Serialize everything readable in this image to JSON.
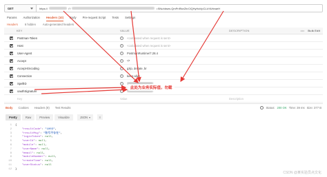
{
  "request": {
    "method": "GET",
    "url_start": "https://",
    "url_mid": "/?",
    "url_end": "=SNuhbses.QmPnRkeZhrClQHyHaVpCLkYAHeaeH"
  },
  "tabs": [
    "Params",
    "Authorization",
    "Headers (10)",
    "Body",
    "Pre-request Script",
    "Tests",
    "Settings"
  ],
  "active_tab_index": 2,
  "subtabs": {
    "headers": "Headers",
    "hidden": "6 hidden",
    "auto": "Auto-generated headers"
  },
  "table": {
    "columns": {
      "key": "KEY",
      "value": "VALUE",
      "description": "DESCRIPTION",
      "bulk_edit": "Bulk Edit",
      "more": "•••"
    },
    "rows": [
      {
        "key": "Postman-Token",
        "value": "<calculated when request is sent>",
        "placeholder": true
      },
      {
        "key": "Host",
        "value": "<calculated when request is sent>",
        "placeholder": true
      },
      {
        "key": "User-Agent",
        "value": "PostmanRuntime/7.28.4",
        "placeholder": false
      },
      {
        "key": "Accept",
        "value": "*/*",
        "placeholder": false
      },
      {
        "key": "Accept-Encoding",
        "value": "gzip, deflate, br",
        "placeholder": false
      },
      {
        "key": "Connection",
        "value": "keep-alive",
        "placeholder": false
      },
      {
        "key": "SpellID",
        "value": "",
        "placeholder": false
      },
      {
        "key": "oauthSignature",
        "value": "",
        "placeholder": false
      }
    ],
    "new_row": {
      "key": "Key",
      "value": "Value",
      "description": "Description"
    }
  },
  "annotation": "此处为业务实际值，勿截",
  "response": {
    "tabs": [
      "Body",
      "Cookies",
      "Headers (9)",
      "Test Results"
    ],
    "status_label": "Status:",
    "status_value": "200 OK",
    "time": "Time: 39 ms",
    "size": "Size: 377 B",
    "views": [
      "Pretty",
      "Raw",
      "Preview",
      "Visualize"
    ],
    "format": "JSON"
  },
  "json_lines": [
    {
      "n": "1",
      "parts": [
        [
          "pun",
          "{"
        ]
      ]
    },
    {
      "n": "2",
      "parts": [
        [
          "key",
          "    \"resultCode\""
        ],
        [
          "pun",
          ": "
        ],
        [
          "str",
          "\"1003\""
        ],
        [
          "pun",
          ","
        ]
      ]
    },
    {
      "n": "3",
      "parts": [
        [
          "key",
          "    \"resultMsg\""
        ],
        [
          "pun",
          ": "
        ],
        [
          "str",
          "\"账号不存在\""
        ],
        [
          "pun",
          ","
        ]
      ]
    },
    {
      "n": "4",
      "parts": [
        [
          "key",
          "    \"loginToken\""
        ],
        [
          "pun",
          ": "
        ],
        [
          "nul",
          "null"
        ],
        [
          "pun",
          ","
        ]
      ]
    },
    {
      "n": "5",
      "parts": [
        [
          "key",
          "    \"userId\""
        ],
        [
          "pun",
          ": "
        ],
        [
          "nul",
          "null"
        ],
        [
          "pun",
          ","
        ]
      ]
    },
    {
      "n": "6",
      "parts": [
        [
          "key",
          "    \"mobile\""
        ],
        [
          "pun",
          ": "
        ],
        [
          "nul",
          "null"
        ],
        [
          "pun",
          ","
        ]
      ]
    },
    {
      "n": "7",
      "parts": [
        [
          "key",
          "    \"userName\""
        ],
        [
          "pun",
          ": "
        ],
        [
          "nul",
          "null"
        ],
        [
          "pun",
          ","
        ]
      ]
    },
    {
      "n": "8",
      "parts": [
        [
          "key",
          "    \"email\""
        ],
        [
          "pun",
          ": "
        ],
        [
          "nul",
          "null"
        ],
        [
          "pun",
          ","
        ]
      ]
    },
    {
      "n": "9",
      "parts": [
        [
          "key",
          "    \"mobileNumber\""
        ],
        [
          "pun",
          ": "
        ],
        [
          "nul",
          "null"
        ],
        [
          "pun",
          ","
        ]
      ]
    },
    {
      "n": "10",
      "parts": [
        [
          "key",
          "    \"createTime\""
        ],
        [
          "pun",
          ": "
        ],
        [
          "nul",
          "null"
        ],
        [
          "pun",
          ","
        ]
      ]
    },
    {
      "n": "11",
      "parts": [
        [
          "key",
          "    \"userStatus\""
        ],
        [
          "pun",
          ": "
        ],
        [
          "nul",
          "null"
        ]
      ]
    },
    {
      "n": "12",
      "parts": [
        [
          "pun",
          "}"
        ]
      ]
    }
  ],
  "watermark": "CSDN @某实验员点文化",
  "colors": {
    "accent": "#e0623a",
    "annotation": "#e53935"
  }
}
